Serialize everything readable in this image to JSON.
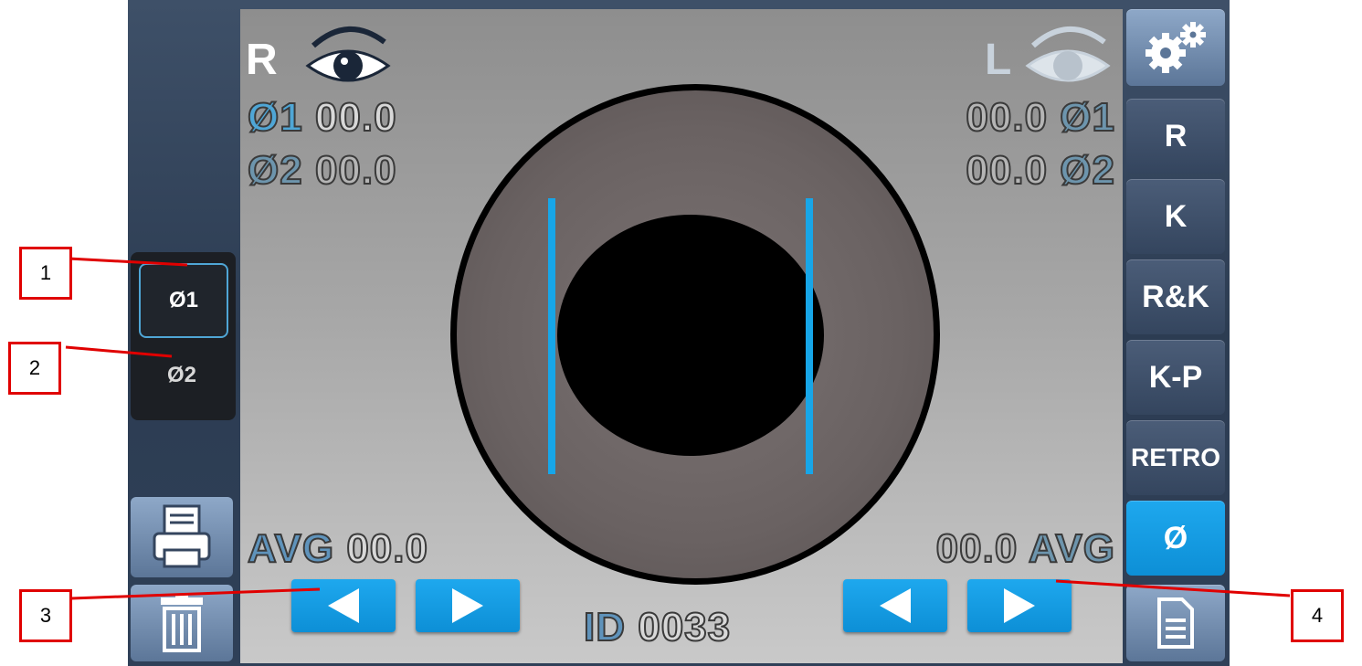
{
  "right_eye": {
    "label": "R",
    "d1_key": "Ø1",
    "d1_value": "00.0",
    "d2_key": "Ø2",
    "d2_value": "00.0",
    "avg_key": "AVG",
    "avg_value": "00.0"
  },
  "left_eye": {
    "label": "L",
    "d1_key": "Ø1",
    "d1_value": "00.0",
    "d2_key": "Ø2",
    "d2_value": "00.0",
    "avg_key": "AVG",
    "avg_value": "00.0"
  },
  "id": {
    "key": "ID",
    "value": "0033"
  },
  "diameter_select": {
    "option1": "Ø1",
    "option2": "Ø2",
    "selected": "Ø1"
  },
  "mode_menu": [
    "R",
    "K",
    "R&K",
    "K-P",
    "RETRO",
    "Ø"
  ],
  "active_mode": "Ø",
  "callouts": [
    "1",
    "2",
    "3",
    "4"
  ],
  "colors": {
    "accent": "#0fa0e6",
    "annotation": "#e00000",
    "measurement_line": "#17a6e8"
  },
  "icons": {
    "settings": "gears-icon",
    "print": "printer-icon",
    "delete": "trash-icon",
    "report": "document-icon"
  }
}
